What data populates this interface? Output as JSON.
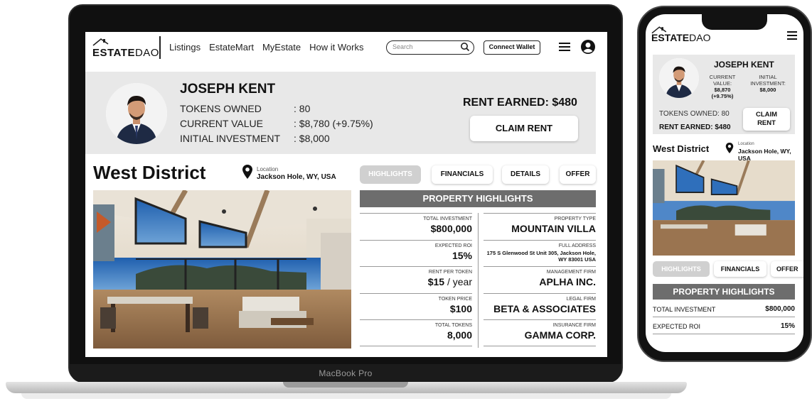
{
  "brand": {
    "name_bold": "ESTATE",
    "name_light": "DAO"
  },
  "nav": {
    "links": [
      "Listings",
      "EstateMart",
      "MyEstate",
      "How it Works"
    ],
    "search_placeholder": "Search",
    "connect_wallet": "Connect Wallet"
  },
  "profile": {
    "name": "JOSEPH KENT",
    "tokens_owned_label": "TOKENS OWNED",
    "tokens_owned_value": ": 80",
    "current_value_label": "CURRENT VALUE",
    "current_value_value": ": $8,780 (+9.75%)",
    "initial_investment_label": "INITIAL INVESTMENT",
    "initial_investment_value": ": $8,000",
    "rent_earned": "RENT EARNED: $480",
    "claim_rent": "CLAIM RENT"
  },
  "property": {
    "district": "West District",
    "location_label": "Location",
    "location": "Jackson Hole, WY, USA",
    "tabs": [
      "HIGHLIGHTS",
      "FINANCIALS",
      "DETAILS",
      "OFFER"
    ],
    "highlights_title": "PROPERTY HIGHLIGHTS",
    "left_items": [
      {
        "label": "TOTAL INVESTMENT",
        "value": "$800,000"
      },
      {
        "label": "EXPECTED ROI",
        "value": "15%"
      },
      {
        "label": "RENT PER TOKEN",
        "value": "$15",
        "suffix": " / year"
      },
      {
        "label": "TOKEN PRICE",
        "value": "$100"
      },
      {
        "label": "TOTAL TOKENS",
        "value": "8,000"
      }
    ],
    "right_items": [
      {
        "label": "PROPERTY TYPE",
        "value": "MOUNTAIN VILLA"
      },
      {
        "label": "FULL ADDRESS",
        "value": "175 S Glenwood St Unit 305, Jackson Hole, WY 83001 USA"
      },
      {
        "label": "MANAGEMENT FIRM",
        "value": "APLHA INC."
      },
      {
        "label": "LEGAL FIRM",
        "value": "BETA & ASSOCIATES"
      },
      {
        "label": "INSURANCE FIRM",
        "value": "GAMMA CORP."
      }
    ]
  },
  "laptop_label": "MacBook Pro",
  "mobile": {
    "current_value_label": "CURRENT VALUE:",
    "current_value": "$8,870",
    "current_value_change": "(+9.75%)",
    "initial_investment_label": "INITIAL INVESTMENT:",
    "initial_investment": "$8,000",
    "tokens_owned": "TOKENS OWNED: 80",
    "rent_earned": "RENT EARNED: $480",
    "claim_rent_1": "CLAIM",
    "claim_rent_2": "RENT",
    "location": "Jackson Hole, WY, USA",
    "tabs": [
      "HIGHLIGHTS",
      "FINANCIALS",
      "OFFER"
    ],
    "rows": [
      {
        "label": "TOTAL INVESTMENT",
        "value": "$800,000"
      },
      {
        "label": "EXPECTED ROI",
        "value": "15%"
      }
    ]
  },
  "colors": {
    "accent_gray": "#6d6d6d",
    "panel_gray": "#e8e8e8",
    "active_tab": "#d0d0d0"
  }
}
